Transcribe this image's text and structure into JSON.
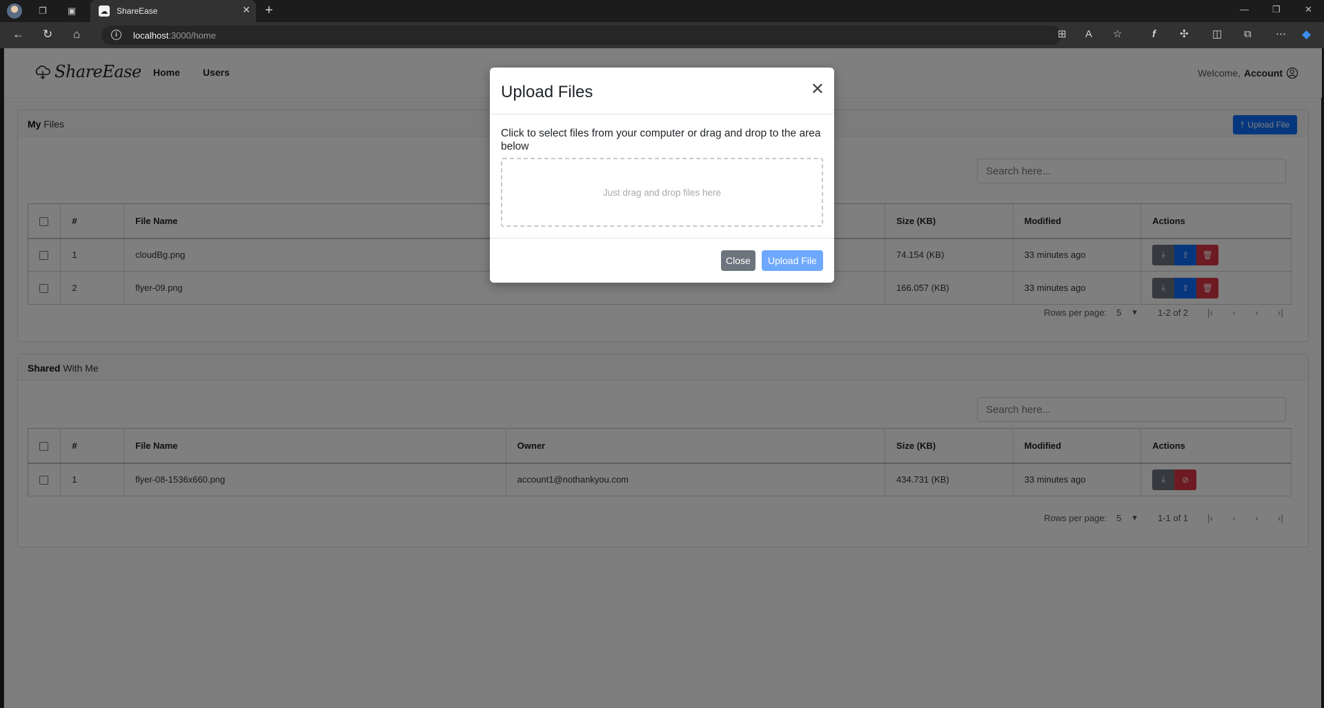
{
  "browser": {
    "tab_title": "ShareEase",
    "url_host": "localhost",
    "url_path": ":3000/home"
  },
  "navbar": {
    "brand": "ShareEase",
    "links": [
      "Home",
      "Users"
    ],
    "welcome": "Welcome,",
    "account": "Account"
  },
  "my_files": {
    "title_bold": "My",
    "title_rest": "Files",
    "upload_button": "Upload File",
    "search_placeholder": "Search here...",
    "columns": [
      "#",
      "File Name",
      "Size (KB)",
      "Modified",
      "Actions"
    ],
    "rows": [
      {
        "num": "1",
        "name": "cloudBg.png",
        "size": "74.154 (KB)",
        "modified": "33 minutes ago"
      },
      {
        "num": "2",
        "name": "flyer-09.png",
        "size": "166.057 (KB)",
        "modified": "33 minutes ago"
      }
    ],
    "pager": {
      "rows_label": "Rows per page:",
      "rows_value": "5",
      "range": "1-2 of 2"
    }
  },
  "shared": {
    "title_bold": "Shared",
    "title_rest": "With Me",
    "search_placeholder": "Search here...",
    "columns": [
      "#",
      "File Name",
      "Owner",
      "Size (KB)",
      "Modified",
      "Actions"
    ],
    "rows": [
      {
        "num": "1",
        "name": "flyer-08-1536x660.png",
        "owner": "account1@nothankyou.com",
        "size": "434.731 (KB)",
        "modified": "33 minutes ago"
      }
    ],
    "pager": {
      "rows_label": "Rows per page:",
      "rows_value": "5",
      "range": "1-1 of 1"
    }
  },
  "modal": {
    "title": "Upload Files",
    "instructions": "Click to select files from your computer or drag and drop to the area below",
    "dropzone_text": "Just drag and drop files here",
    "close_button": "Close",
    "upload_button": "Upload File"
  },
  "colors": {
    "primary": "#0d6efd",
    "secondary": "#6c757d",
    "danger": "#dc3545",
    "primary_disabled": "#6ea8fe"
  }
}
